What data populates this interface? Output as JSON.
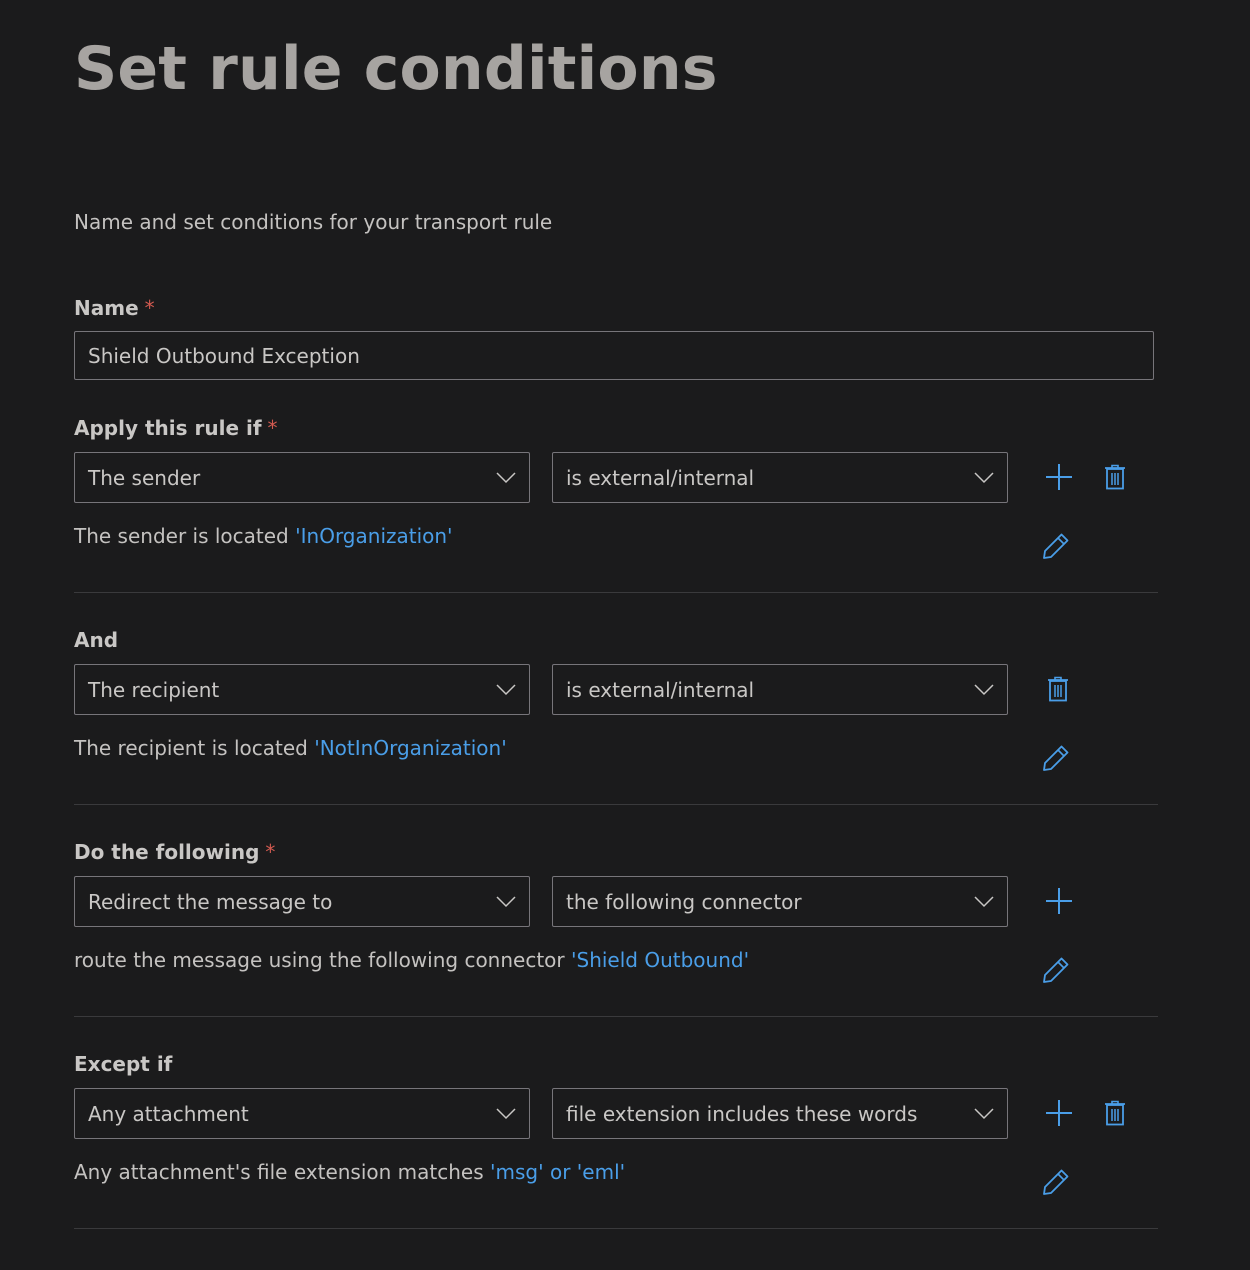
{
  "page": {
    "title": "Set rule conditions",
    "subtitle": "Name and set conditions for your transport rule"
  },
  "name_field": {
    "label": "Name",
    "required_mark": "*",
    "value": "Shield Outbound Exception"
  },
  "apply_rule": {
    "label": "Apply this rule if",
    "required_mark": "*",
    "subject": "The sender",
    "predicate": "is external/internal",
    "description_prefix": "The sender is located ",
    "description_value": "'InOrganization'"
  },
  "and_condition": {
    "label": "And",
    "subject": "The recipient",
    "predicate": "is external/internal",
    "description_prefix": "The recipient is located ",
    "description_value": "'NotInOrganization'"
  },
  "action": {
    "label": "Do the following",
    "required_mark": "*",
    "subject": "Redirect the message to",
    "predicate": "the following connector",
    "description_prefix": "route the message using the following connector ",
    "description_value": "'Shield Outbound'"
  },
  "exception": {
    "label": "Except if",
    "subject": "Any attachment",
    "predicate": "file extension includes these words",
    "description_prefix": "Any attachment's file extension matches ",
    "description_value": "'msg' or 'eml'"
  },
  "colors": {
    "background": "#1b1b1c",
    "accent": "#4a9ee8",
    "required": "#d25a50",
    "border": "#77757a"
  },
  "icons": {
    "add": "plus-icon",
    "delete": "trash-icon",
    "edit": "pencil-icon",
    "dropdown": "chevron-down-icon"
  }
}
